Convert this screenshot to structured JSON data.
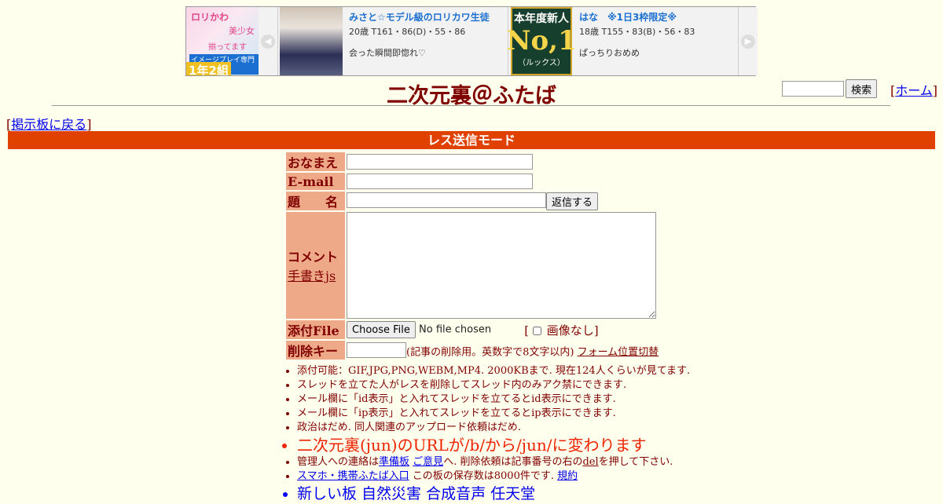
{
  "ad": {
    "left_banner": {
      "line1": "ロリかわ",
      "line2": "美少女",
      "line3": "揃ってます",
      "line4": "イメージプレイ専門店",
      "line5": "1年2組"
    },
    "items": [
      {
        "name": "みさと☆モデル級のロリカワ生徒",
        "stats": "20歳 T161・86(D)・55・86",
        "message": "会った瞬間即惚れ♡"
      },
      {
        "name": "はな　※1日3枠限定※",
        "stats": "18歳 T155・83(B)・56・83",
        "message": "ぱっちりおめめ"
      }
    ],
    "badge": {
      "top": "本年度新人",
      "middle": "No,1",
      "bottom": "（ルックス）"
    }
  },
  "header": {
    "title": "二次元裏＠ふたば",
    "search_button": "検索",
    "home_bracket_open": "[",
    "home_link": "ホーム",
    "home_bracket_close": "]"
  },
  "nav": {
    "back_open": "[",
    "back_link": "掲示板に戻る",
    "back_close": "]"
  },
  "mode_bar": "レス送信モード",
  "form": {
    "name_label": "おなまえ",
    "email_label": "E-mail",
    "subject_label": "題　　名",
    "submit_label": "返信する",
    "comment_label": "コメント",
    "handwrite_link": "手書きjs",
    "file_label": "添付File",
    "file_button": "Choose File",
    "file_status": "No file chosen",
    "noimg_open": "[",
    "noimg_label": "画像なし",
    "noimg_close": "]",
    "delkey_label": "削除キー",
    "delkey_note": "(記事の削除用。英数字で8文字以内)",
    "form_switch_link": "フォーム位置切替"
  },
  "notes": {
    "n1": "添付可能：GIF,JPG,PNG,WEBM,MP4. 2000KBまで. 現在124人くらいが見てます.",
    "n2": "スレッドを立てた人がレスを削除してスレッド内のみアク禁にできます.",
    "n3": "メール欄に「id表示」と入れてスレッドを立てるとid表示にできます.",
    "n4": "メール欄に「ip表示」と入れてスレッドを立てるとip表示にできます.",
    "n5": "政治はだめ. 同人関連のアップロード依頼はだめ.",
    "n6": "二次元裏(jun)のURLが/b/から/jun/に変わります",
    "n7_prefix": "管理人への連絡は",
    "n7_link1": "準備板",
    "n7_link2": "ご意見",
    "n7_middle": "へ. 削除依頼は記事番号の右の",
    "n7_del": "del",
    "n7_suffix": "を押して下さい.",
    "n8_link": "スマホ・携帯ふたば入口",
    "n8_middle": " この板の保存数は8000件です. ",
    "n8_rules": "規約",
    "n9": "新しい板 自然災害 合成音声 任天堂"
  },
  "colors": {
    "background": "#ffffee",
    "text": "#800000",
    "mode_bar": "#e04000",
    "label_bg": "#eeaa88",
    "alert": "#ee2200",
    "link": "#0000ee"
  }
}
